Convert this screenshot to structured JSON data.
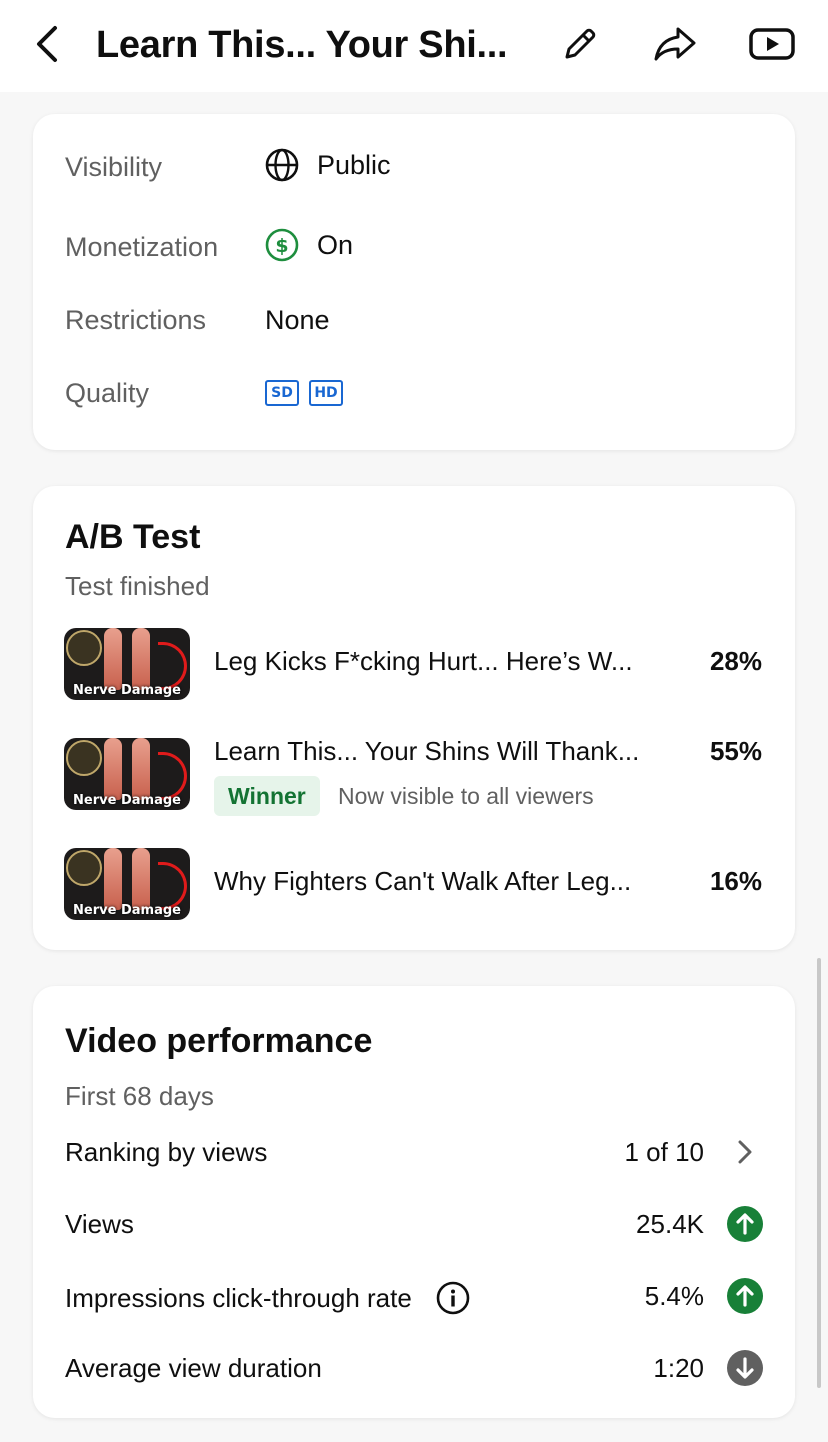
{
  "header": {
    "title": "Learn This... Your Shi...",
    "back_icon": "arrow-left-icon",
    "edit_icon": "pencil-icon",
    "share_icon": "share-icon",
    "youtube_icon": "youtube-icon"
  },
  "details": {
    "visibility": {
      "label": "Visibility",
      "value": "Public",
      "icon": "globe-icon"
    },
    "monetization": {
      "label": "Monetization",
      "value": "On",
      "icon": "dollar-circle-icon",
      "color": "#1e8e3e"
    },
    "restrictions": {
      "label": "Restrictions",
      "value": "None"
    },
    "quality": {
      "label": "Quality",
      "badges": [
        "SD",
        "HD"
      ],
      "color": "#1967d2"
    }
  },
  "ab_test": {
    "title": "A/B Test",
    "status": "Test finished",
    "variants": [
      {
        "title": "Leg Kicks F*cking Hurt... Here’s W...",
        "percent": "28%",
        "thumb_caption": "Nerve Damage"
      },
      {
        "title": "Learn This... Your Shins Will Thank...",
        "percent": "55%",
        "thumb_caption": "Nerve Damage",
        "badge": "Winner",
        "note": "Now visible to all viewers"
      },
      {
        "title": "Why Fighters Can't Walk After Leg...",
        "percent": "16%",
        "thumb_caption": "Nerve Damage"
      }
    ],
    "winner_color": "#137333"
  },
  "performance": {
    "title": "Video performance",
    "period": "First 68 days",
    "rows": [
      {
        "label": "Ranking by views",
        "value": "1 of 10",
        "icon": "chevron-right-icon"
      },
      {
        "label": "Views",
        "value": "25.4K",
        "icon": "arrow-up-circle-icon",
        "trend_color": "#188038"
      },
      {
        "label": "Impressions click-through rate",
        "value": "5.4%",
        "icon": "arrow-up-circle-icon",
        "trend_color": "#188038",
        "info_icon": "info-icon"
      },
      {
        "label": "Average view duration",
        "value": "1:20",
        "icon": "arrow-down-circle-icon",
        "trend_color": "#606060"
      }
    ]
  }
}
